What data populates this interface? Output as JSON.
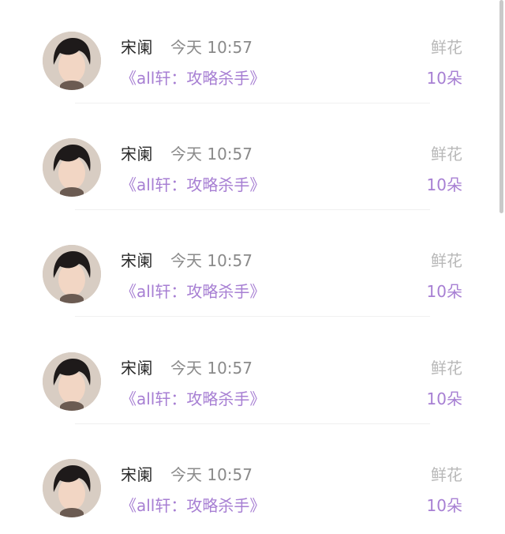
{
  "items": [
    {
      "name": "宋阑",
      "time": "今天 10:57",
      "book": "《all轩：攻略杀手》",
      "gift_label": "鲜花",
      "gift_count": "10朵"
    },
    {
      "name": "宋阑",
      "time": "今天 10:57",
      "book": "《all轩：攻略杀手》",
      "gift_label": "鲜花",
      "gift_count": "10朵"
    },
    {
      "name": "宋阑",
      "time": "今天 10:57",
      "book": "《all轩：攻略杀手》",
      "gift_label": "鲜花",
      "gift_count": "10朵"
    },
    {
      "name": "宋阑",
      "time": "今天 10:57",
      "book": "《all轩：攻略杀手》",
      "gift_label": "鲜花",
      "gift_count": "10朵"
    },
    {
      "name": "宋阑",
      "time": "今天 10:57",
      "book": "《all轩：攻略杀手》",
      "gift_label": "鲜花",
      "gift_count": "10朵"
    }
  ],
  "colors": {
    "accent": "#a77fd3",
    "name": "#2a2a2a",
    "time": "#8a8a8a",
    "gift_label": "#b8b8b8"
  }
}
